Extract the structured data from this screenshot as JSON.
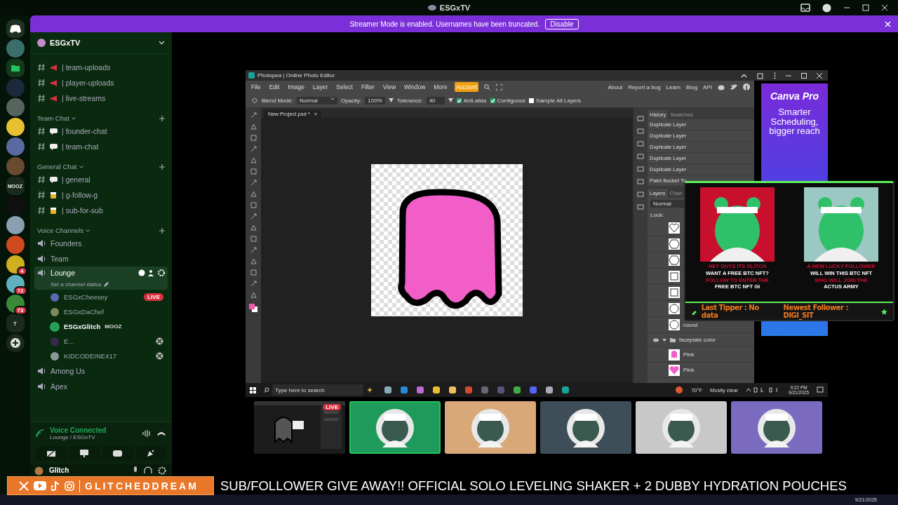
{
  "window": {
    "title": "ESGxTV"
  },
  "notice": {
    "text": "Streamer Mode is enabled. Usernames have been truncated.",
    "button": "Disable"
  },
  "servers": [
    {
      "kind": "discord"
    },
    {
      "kind": "avatar",
      "color": "#3a6e6a"
    },
    {
      "kind": "folder"
    },
    {
      "kind": "avatar",
      "color": "#1b2a3a"
    },
    {
      "kind": "avatar",
      "color": "#56645e"
    },
    {
      "kind": "avatar",
      "color": "#e8c030"
    },
    {
      "kind": "avatar",
      "color": "#5a6aa0"
    },
    {
      "kind": "avatar",
      "color": "#6a4a30"
    },
    {
      "kind": "label",
      "label": "MOOZ"
    },
    {
      "kind": "avatar",
      "color": "#101010"
    },
    {
      "kind": "avatar",
      "color": "#8aa0b0"
    },
    {
      "kind": "avatar",
      "color": "#d04a20"
    },
    {
      "kind": "avatar",
      "color": "#d0b020",
      "badge": "4"
    },
    {
      "kind": "avatar",
      "color": "#60b0c0",
      "badge": "72"
    },
    {
      "kind": "avatar",
      "color": "#3a8a3a",
      "badge": "73"
    },
    {
      "kind": "label",
      "label": "T"
    },
    {
      "kind": "add"
    }
  ],
  "server_name": "ESGxTV",
  "channel_groups": [
    {
      "items": [
        {
          "kind": "megaphone",
          "name": "| team-uploads",
          "selected": false
        },
        {
          "kind": "megaphone",
          "name": "| player-uploads",
          "selected": false
        },
        {
          "kind": "megaphone",
          "name": "| live-streams",
          "selected": false
        }
      ]
    },
    {
      "title": "Team Chat",
      "items": [
        {
          "kind": "speech",
          "name": "| founder-chat",
          "selected": false
        },
        {
          "kind": "speech",
          "name": "| team-chat",
          "selected": false
        }
      ]
    },
    {
      "title": "General Chat",
      "items": [
        {
          "kind": "speech",
          "name": "| general",
          "selected": false
        },
        {
          "kind": "beer",
          "name": "| g-follow-g",
          "selected": false
        },
        {
          "kind": "beer",
          "name": "| sub-for-sub",
          "selected": false
        }
      ]
    },
    {
      "title": "Voice Channels",
      "items": [
        {
          "kind": "voice",
          "name": "Founders",
          "selected": false
        },
        {
          "kind": "voice",
          "name": "Team",
          "selected": false
        },
        {
          "kind": "voice",
          "name": "Lounge",
          "selected": true,
          "status": "Set a channel status",
          "members": [
            {
              "name": "ESGxCheesey",
              "color": "#5a6ab0",
              "speaking": false,
              "live": "LIVE"
            },
            {
              "name": "ESGxDaChef",
              "color": "#7a8a5a",
              "speaking": false
            },
            {
              "name": "ESGxGlitch",
              "color": "#2a9a5a",
              "speaking": true,
              "activity": "MOOZ"
            },
            {
              "name": "E…",
              "color": "#3a2a4a",
              "speaking": false,
              "xbox": true
            },
            {
              "name": "KIDCODEINE417",
              "color": "#8a9a9a",
              "speaking": false,
              "xbox": true
            }
          ]
        },
        {
          "kind": "voice",
          "name": "Among Us",
          "selected": false
        },
        {
          "kind": "voice",
          "name": "Apex",
          "selected": false
        }
      ]
    }
  ],
  "voice": {
    "title": "Voice Connected",
    "subtitle": "Lounge / ESGxTV"
  },
  "user": {
    "name": "Glitch"
  },
  "photopea": {
    "title": "Photopea | Online Photo Editor",
    "menu": [
      {
        "label": "File",
        "selected": false
      },
      {
        "label": "Edit",
        "selected": false
      },
      {
        "label": "Image",
        "selected": false
      },
      {
        "label": "Layer",
        "selected": false
      },
      {
        "label": "Select",
        "selected": false
      },
      {
        "label": "Filter",
        "selected": false
      },
      {
        "label": "View",
        "selected": false
      },
      {
        "label": "Window",
        "selected": false
      },
      {
        "label": "More",
        "selected": false
      },
      {
        "label": "Account",
        "selected": true
      }
    ],
    "links": [
      "About",
      "Report a bug",
      "Learn",
      "Blog",
      "API"
    ],
    "blend_label": "Blend Mode:",
    "blend": "Normal",
    "opacity_label": "Opacity:",
    "opacity": "100%",
    "tolerance_label": "Tolerance:",
    "tolerance": "40",
    "options": [
      {
        "label": "Anti-alias",
        "checked": true
      },
      {
        "label": "Contiguous",
        "checked": true
      },
      {
        "label": "Sample All Layers",
        "checked": false
      }
    ],
    "document_tab": {
      "label": "New Project.psd *",
      "close": "×"
    },
    "history_tabs": [
      {
        "label": "History",
        "selected": true
      },
      {
        "label": "Swatches",
        "selected": false
      }
    ],
    "history": [
      "Duplicate Layer",
      "Duplicate Layer",
      "Duplicate Layer",
      "Duplicate Layer",
      "Duplicate Layer",
      "Paint Bucket To"
    ],
    "layer_tabs": [
      {
        "label": "Layers",
        "selected": true
      },
      {
        "label": "Chan",
        "selected": false
      }
    ],
    "layer_blend": "Normal",
    "lock": "Lock:",
    "layers": [
      {
        "kind": "heart"
      },
      {
        "kind": "hexagon"
      },
      {
        "kind": "hexagon"
      },
      {
        "kind": "square"
      },
      {
        "kind": "square"
      },
      {
        "kind": "circle"
      },
      {
        "kind": "circle",
        "name": "round"
      },
      {
        "kind": "group",
        "name": "faceplate color",
        "expanded": true,
        "children": [
          {
            "kind": "ghost",
            "name": "Pink"
          },
          {
            "kind": "pinkheart",
            "name": "Pink"
          }
        ]
      }
    ],
    "ad": {
      "brand": "Canva Pro",
      "text": "Smarter Scheduling, bigger reach"
    },
    "taskbar": {
      "search_placeholder": "Type here to search",
      "temperature": "70°F",
      "weather": "Mostly clear",
      "time": "9:22 PM",
      "date": "9/21/2025"
    }
  },
  "overlay": {
    "cards": [
      {
        "color": "#c8102e",
        "lines": [
          {
            "text": "HEY GUYS ITS GLITCH",
            "color": "#c8102e"
          },
          {
            "text": "WANT A FREE BTC NFT?",
            "color": "#ffffff"
          },
          {
            "text": "FOLLOW TO ENTER THE",
            "color": "#c8102e"
          },
          {
            "text": "FREE BTC NFT GI",
            "color": "#ffffff"
          }
        ]
      },
      {
        "color": "#9cc8c4",
        "lines": [
          {
            "text": "A NEW LUCKY FOLLOWER",
            "color": "#c8102e"
          },
          {
            "text": "WILL WIN THIS BTC NFT",
            "color": "#ffffff"
          },
          {
            "text": "WHO WILL JOIN THE",
            "color": "#c8102e"
          },
          {
            "text": "ACTUS ARMY",
            "color": "#ffffff"
          }
        ]
      }
    ],
    "ticker": [
      "Last Tipper : No data",
      "Newest Follower : DIGI_SIT"
    ]
  },
  "tiles": [
    {
      "kind": "screen",
      "live": "LIVE",
      "selected": false
    },
    {
      "kind": "avatar",
      "color": "#1e9a5a",
      "selected": true
    },
    {
      "kind": "avatar",
      "color": "#d8a878",
      "selected": false
    },
    {
      "kind": "avatar",
      "color": "#3e4e58",
      "selected": false
    },
    {
      "kind": "avatar",
      "color": "#c8c8c8",
      "selected": false
    },
    {
      "kind": "avatar",
      "color": "#7a6ac0",
      "selected": false
    }
  ],
  "banner": {
    "handle": "GLITCHEDDREAM",
    "marquee": "SUB/FOLLOWER GIVE AWAY!! OFFICIAL SOLO LEVELING SHAKER + 2 DUBBY HYDRATION POUCHES"
  },
  "os_taskbar": {
    "date": "9/21/2025"
  }
}
